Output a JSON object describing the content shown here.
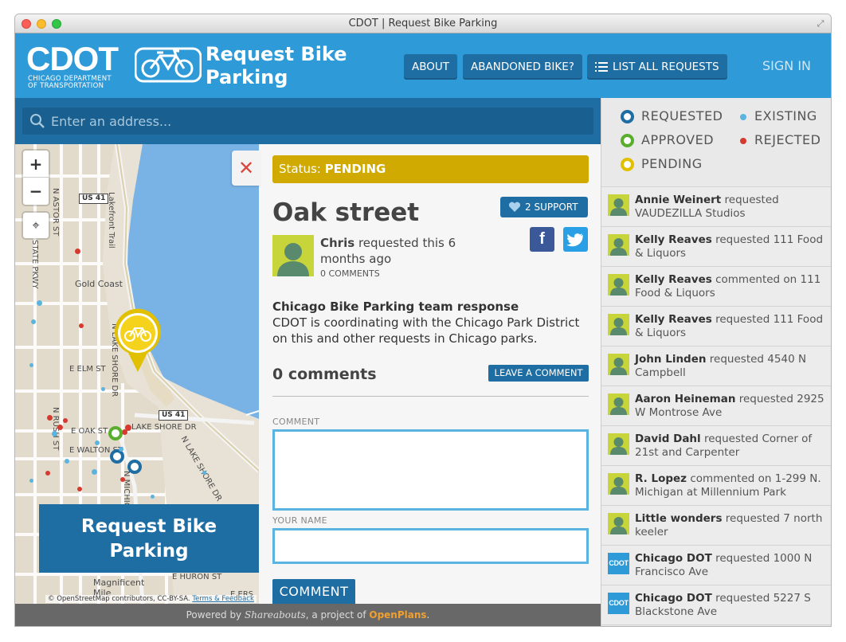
{
  "window": {
    "title": "CDOT | Request Bike Parking"
  },
  "header": {
    "logo": "CDOT",
    "logo_sub_1": "CHICAGO DEPARTMENT",
    "logo_sub_2": "OF TRANSPORTATION",
    "site_title": "Request Bike Parking",
    "nav": {
      "about": "ABOUT",
      "abandoned": "ABANDONED BIKE?",
      "list": "LIST ALL REQUESTS"
    },
    "signin": "SIGN IN"
  },
  "search": {
    "placeholder": "Enter an address..."
  },
  "map": {
    "zoom_in": "+",
    "zoom_out": "−",
    "labels": {
      "n_astor": "N ASTOR ST",
      "state_pkwy": "STATE PKWY",
      "gold_coast": "Gold Coast",
      "lake_shore": "N LAKE SHORE DR",
      "e_elm": "E ELM ST",
      "e_oak": "E OAK ST",
      "lake_shore_e": "LAKE SHORE DR",
      "e_walton": "E WALTON ST",
      "n_rush": "N RUSH ST",
      "michigan": "N MICHIGAN",
      "n_lake_shore_2": "N LAKE SHORE DR",
      "e_huron": "E HURON ST",
      "lakefront_trail": "Lakefront Trail",
      "magnificent": "Magnificent Mile",
      "us41": "US 41",
      "e_ers": "E ERS"
    },
    "attribution": "© OpenStreetMap contributors, CC-BY-SA.",
    "attribution_link": "Terms & Feedback",
    "cta": "Request Bike Parking"
  },
  "detail": {
    "close": "✕",
    "status_label": "Status:",
    "status_value": "PENDING",
    "title": "Oak street",
    "support": "2 SUPPORT",
    "share_fb": "f",
    "submitter_name": "Chris",
    "submitter_text": "requested this 6 months ago",
    "comments_count": "0 COMMENTS",
    "response_head": "Chicago Bike Parking team response",
    "response_body": "CDOT is coordinating with the Chicago Park District on this and other requests in Chicago parks.",
    "comments_head": "0 comments",
    "leave_comment": "LEAVE A COMMENT",
    "comment_label": "COMMENT",
    "name_label": "YOUR NAME",
    "submit": "COMMENT"
  },
  "legend": {
    "requested": "REQUESTED",
    "existing": "EXISTING",
    "approved": "APPROVED",
    "rejected": "REJECTED",
    "pending": "PENDING",
    "colors": {
      "requested": "#1e6da3",
      "existing": "#5bb4e0",
      "approved": "#5aae2e",
      "rejected": "#d63a2f",
      "pending": "#e0c000"
    }
  },
  "activity": [
    {
      "user": "Annie Weinert",
      "action": "requested",
      "place": "VAUDEZILLA Studios",
      "avatar": "person"
    },
    {
      "user": "Kelly Reaves",
      "action": "requested",
      "place": "111 Food & Liquors",
      "avatar": "person"
    },
    {
      "user": "Kelly Reaves",
      "action": "commented on",
      "place": "111 Food & Liquors",
      "avatar": "person"
    },
    {
      "user": "Kelly Reaves",
      "action": "requested",
      "place": "111 Food & Liquors",
      "avatar": "person"
    },
    {
      "user": "John Linden",
      "action": "requested",
      "place": "4540 N Campbell",
      "avatar": "person"
    },
    {
      "user": "Aaron Heineman",
      "action": "requested",
      "place": "2925 W Montrose Ave",
      "avatar": "person"
    },
    {
      "user": "David Dahl",
      "action": "requested",
      "place": "Corner of 21st and Carpenter",
      "avatar": "person"
    },
    {
      "user": "R. Lopez",
      "action": "commented on",
      "place": "1-299 N. Michigan at Millennium Park",
      "avatar": "person"
    },
    {
      "user": "Little wonders",
      "action": "requested",
      "place": "7 north keeler",
      "avatar": "person"
    },
    {
      "user": "Chicago DOT",
      "action": "requested",
      "place": "1000 N Francisco Ave",
      "avatar": "CDOT"
    },
    {
      "user": "Chicago DOT",
      "action": "requested",
      "place": "5227 S Blackstone Ave",
      "avatar": "CDOT"
    }
  ],
  "footer": {
    "prefix": "Powered by",
    "brand": "Shareabouts",
    "mid": ", a project of",
    "org": "OpenPlans",
    "suffix": "."
  }
}
